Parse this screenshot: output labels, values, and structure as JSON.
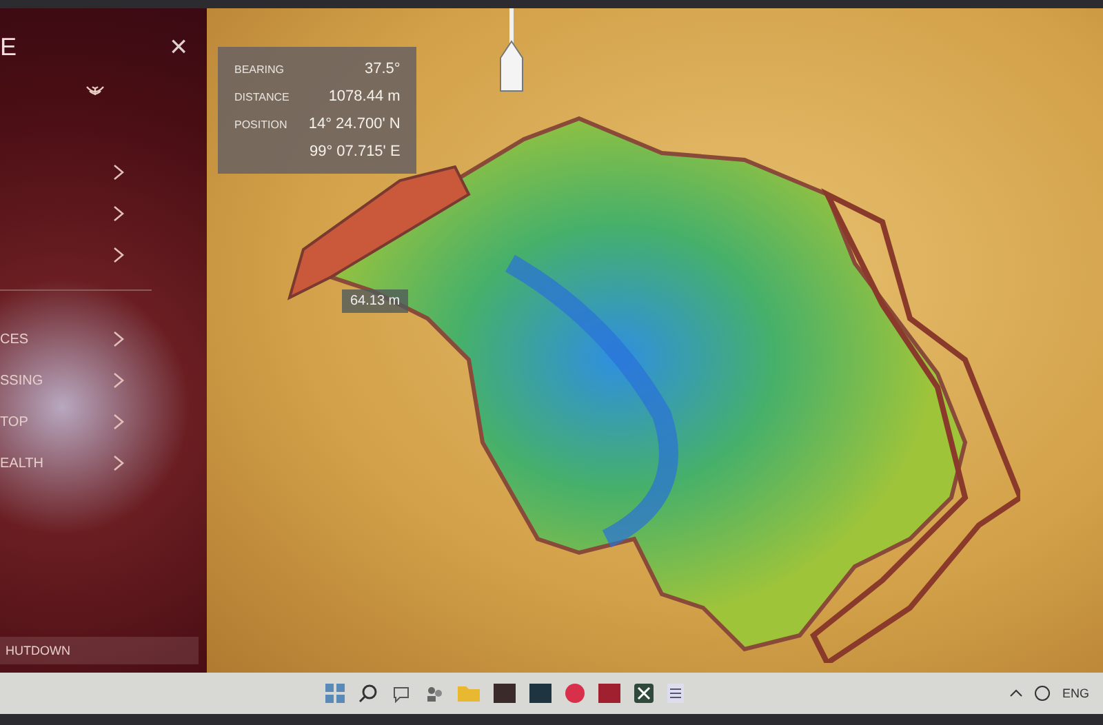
{
  "sidebar": {
    "title": "E",
    "close": "×",
    "items": [
      {
        "kind": "chevron"
      },
      {
        "kind": "chevron"
      },
      {
        "kind": "chevron"
      },
      {
        "kind": "divider"
      },
      {
        "kind": "chevron",
        "label": "CES"
      },
      {
        "kind": "chevron",
        "label": "SSING"
      },
      {
        "kind": "chevron",
        "label": "TOP"
      },
      {
        "kind": "chevron",
        "label": "EALTH"
      }
    ],
    "shutdown": "HUTDOWN"
  },
  "info_panel": {
    "rows": [
      {
        "label": "BEARING",
        "value": "37.5°"
      },
      {
        "label": "DISTANCE",
        "value": "1078.44 m"
      },
      {
        "label": "POSITION",
        "value": "14° 24.700' N"
      },
      {
        "value": "99° 07.715' E"
      }
    ]
  },
  "measure_label": "64.13 m",
  "taskbar": {
    "language": "ENG"
  }
}
